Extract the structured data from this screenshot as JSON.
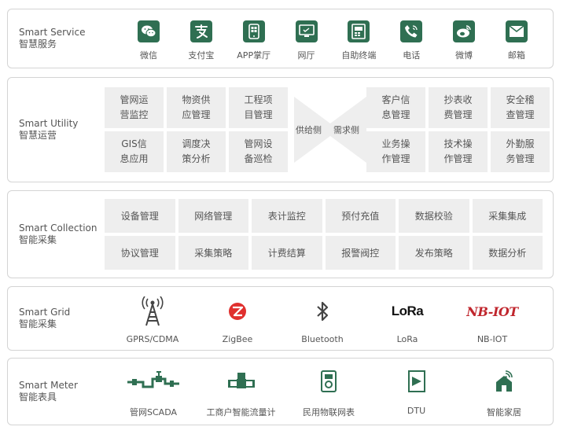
{
  "colors": {
    "accent": "#2f6f52",
    "cell_bg": "#eeeeee",
    "border": "#d4d4d4",
    "nbiot_red": "#c0262d",
    "zigbee_red": "#e0302e"
  },
  "layers": {
    "service": {
      "title_en": "Smart Service",
      "title_cn": "智慧服务",
      "items": [
        {
          "label": "微信",
          "icon": "wechat-icon"
        },
        {
          "label": "支付宝",
          "icon": "alipay-icon"
        },
        {
          "label": "APP掌厅",
          "icon": "app-phone-icon"
        },
        {
          "label": "网厅",
          "icon": "monitor-icon"
        },
        {
          "label": "自助终端",
          "icon": "kiosk-icon"
        },
        {
          "label": "电话",
          "icon": "phone-icon"
        },
        {
          "label": "微博",
          "icon": "weibo-icon"
        },
        {
          "label": "邮箱",
          "icon": "mail-icon"
        }
      ]
    },
    "utility": {
      "title_en": "Smart Utility",
      "title_cn": "智慧运营",
      "supply_side": [
        "管网运营监控",
        "物资供应管理",
        "工程项目管理",
        "GIS信息应用",
        "调度决策分析",
        "管网设备巡检"
      ],
      "demand_side": [
        "客户信息管理",
        "抄表收费管理",
        "安全稽查管理",
        "业务操作管理",
        "技术操作管理",
        "外勤服务管理"
      ],
      "supply_label": "供给侧",
      "demand_label": "需求侧"
    },
    "collection": {
      "title_en": "Smart Collection",
      "title_cn": "智能采集",
      "cells": [
        "设备管理",
        "网络管理",
        "表计监控",
        "预付充值",
        "数据校验",
        "采集集成",
        "协议管理",
        "采集策略",
        "计费结算",
        "报警阀控",
        "发布策略",
        "数据分析"
      ]
    },
    "grid": {
      "title_en": "Smart Grid",
      "title_cn": "智能采集",
      "items": [
        {
          "label": "GPRS/CDMA",
          "icon": "antenna-icon"
        },
        {
          "label": "ZigBee",
          "icon": "zigbee-icon"
        },
        {
          "label": "Bluetooth",
          "icon": "bluetooth-icon"
        },
        {
          "label": "LoRa",
          "icon": "lora-logo",
          "logo_text": "LoRa"
        },
        {
          "label": "NB-IOT",
          "icon": "nbiot-logo",
          "logo_text": "NB-IOT"
        }
      ]
    },
    "meter": {
      "title_en": "Smart Meter",
      "title_cn": "智能表具",
      "items": [
        {
          "label": "管网SCADA",
          "icon": "pipeline-icon"
        },
        {
          "label": "工商户智能流量计",
          "icon": "flowmeter-icon"
        },
        {
          "label": "民用物联网表",
          "icon": "gas-meter-icon"
        },
        {
          "label": "DTU",
          "icon": "dtu-icon"
        },
        {
          "label": "智能家居",
          "icon": "smart-home-icon"
        }
      ]
    }
  }
}
